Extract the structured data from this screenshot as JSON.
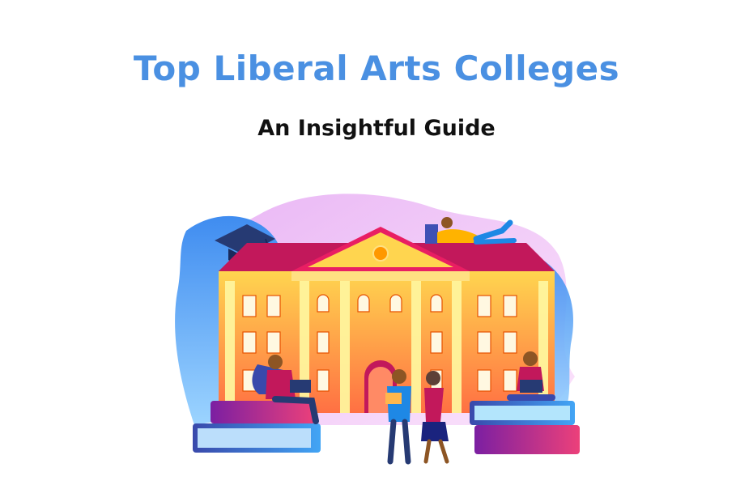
{
  "header": {
    "title": "Top Liberal Arts Colleges",
    "subtitle": "An Insightful Guide"
  },
  "colors": {
    "title": "#4a90e2",
    "subtitle": "#111111",
    "roof": "#c2185b",
    "building_top": "#ffd54f",
    "building_bottom": "#ff7043",
    "blob_blue": "#42a5f5",
    "blob_pink": "#f3c6f0",
    "book_pink": "#ec407a",
    "book_blue": "#5c6bc0"
  },
  "illustration": {
    "subject": "college-building-with-students-icon"
  }
}
